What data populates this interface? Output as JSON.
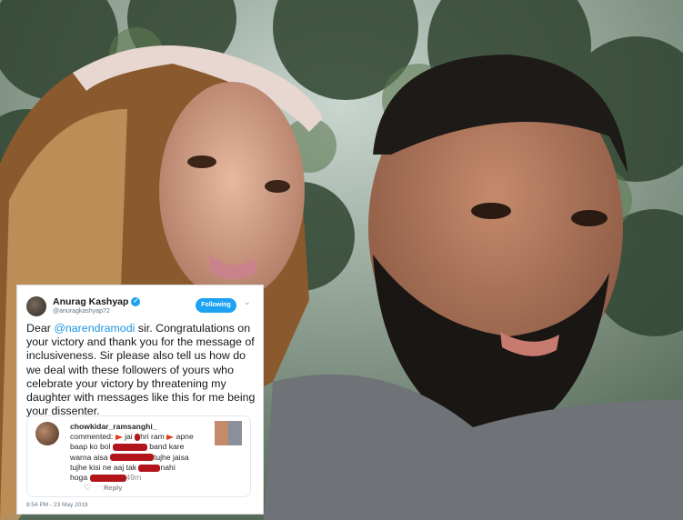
{
  "tweet": {
    "author_name": "Anurag Kashyap",
    "author_handle": "@anuragkashyap72",
    "follow_label": "Following",
    "text_before_mention": "Dear ",
    "mention": "@narendramodi",
    "text_after_mention": " sir. Congratulations on your victory and thank you for the message of inclusiveness. Sir please also tell us how do we deal with these followers of yours who celebrate your victory by threatening my daughter with messages like this for me being your dissenter.",
    "timestamp": "8:54 PM - 23 May 2019"
  },
  "comment": {
    "username": "chowkidar_ramsanghi_",
    "verb": "commented:",
    "frag_jai": "jai",
    "frag_shri_ram": "hri ram",
    "frag_apne": "apne",
    "frag_baap_ko_bol": "baap ko bol",
    "frag_band_kare": "band kare",
    "frag_warna_aisa": "warna aisa",
    "frag_tujhe_jaisa": "tujhe jaisa",
    "frag_tujhe_kisi": "tujhe kisi ne aaj tak",
    "frag_nahi": "nahi",
    "frag_hoga": "hoga",
    "frag_time": "49m",
    "reply_label": "Reply"
  },
  "icons": {
    "verified": "verified-badge-icon",
    "chevron": "chevron-down-icon",
    "heart": "heart-outline-icon",
    "flag": "flag-icon"
  },
  "colors": {
    "twitter_blue": "#1da1f2",
    "mention": "#1b95e0",
    "redaction": "#b2161b"
  }
}
